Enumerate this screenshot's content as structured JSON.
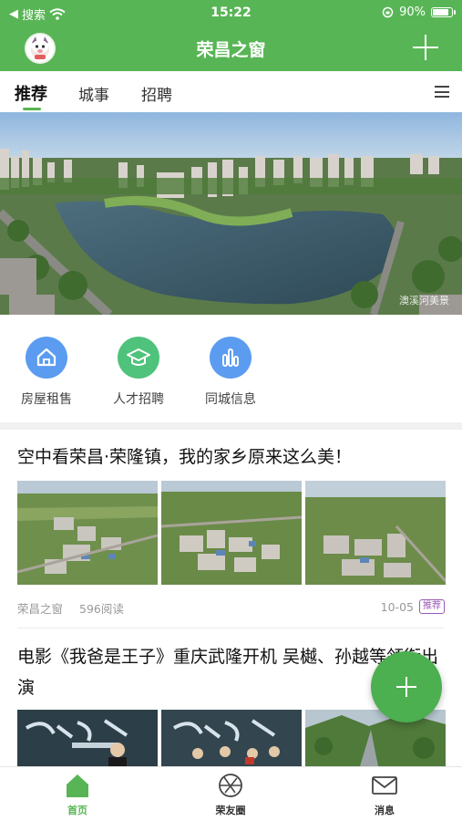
{
  "status_bar": {
    "carrier": "搜索",
    "time": "15:22",
    "battery_text": "90%",
    "battery_level": 0.9
  },
  "app_bar": {
    "title": "荣昌之窗",
    "add_icon": "plus-icon"
  },
  "tabs": [
    {
      "label": "推荐",
      "active": true
    },
    {
      "label": "城事",
      "active": false
    },
    {
      "label": "招聘",
      "active": false
    }
  ],
  "banner": {
    "credit": "澳溪河美景"
  },
  "quick_links": [
    {
      "label": "房屋租售",
      "icon": "house-icon",
      "color": "#5b9cf0"
    },
    {
      "label": "人才招聘",
      "icon": "graduation-cap-icon",
      "color": "#4fc27b"
    },
    {
      "label": "同城信息",
      "icon": "bar-chart-icon",
      "color": "#5b9cf0"
    }
  ],
  "articles": [
    {
      "title": "空中看荣昌·荣隆镇，我的家乡原来这么美！",
      "source": "荣昌之窗",
      "reads": "596阅读",
      "date": "10-05",
      "tag": "推荐"
    },
    {
      "title": "电影《我爸是王子》重庆武隆开机 吴樾、孙越等领衔出演"
    }
  ],
  "bottom_nav": [
    {
      "label": "首页",
      "icon": "home-icon",
      "active": true
    },
    {
      "label": "荣友圈",
      "icon": "aperture-icon",
      "active": false
    },
    {
      "label": "消息",
      "icon": "mail-icon",
      "active": false
    }
  ],
  "colors": {
    "brand": "#58b555",
    "fab": "#4caf50",
    "tag": "#9b59b6"
  }
}
